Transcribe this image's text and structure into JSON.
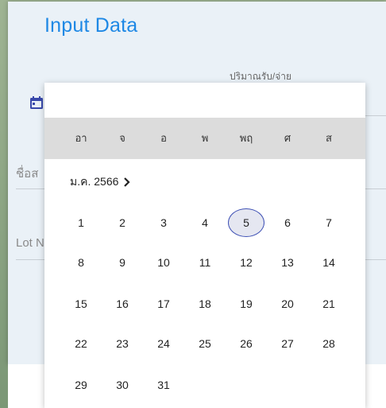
{
  "header": {
    "title": "Input Data"
  },
  "form": {
    "quantity_label": "ปริมาณรับ/จ่าย",
    "name_label_partial": "ชื่อส",
    "lot_label_partial": "Lot N"
  },
  "datepicker": {
    "weekdays": [
      "อา",
      "จ",
      "อ",
      "พ",
      "พฤ",
      "ศ",
      "ส"
    ],
    "month_label": "ม.ค. 2566",
    "selected_day": "5",
    "days": [
      "1",
      "2",
      "3",
      "4",
      "5",
      "6",
      "7",
      "8",
      "9",
      "10",
      "11",
      "12",
      "13",
      "14",
      "15",
      "16",
      "17",
      "18",
      "19",
      "20",
      "21",
      "22",
      "23",
      "24",
      "25",
      "26",
      "27",
      "28",
      "29",
      "30",
      "31"
    ]
  },
  "colors": {
    "accent": "#1e88e5",
    "selection": "#3f51b5"
  },
  "icons": {
    "date": "calendar-icon",
    "next": "chevron-right-icon"
  }
}
